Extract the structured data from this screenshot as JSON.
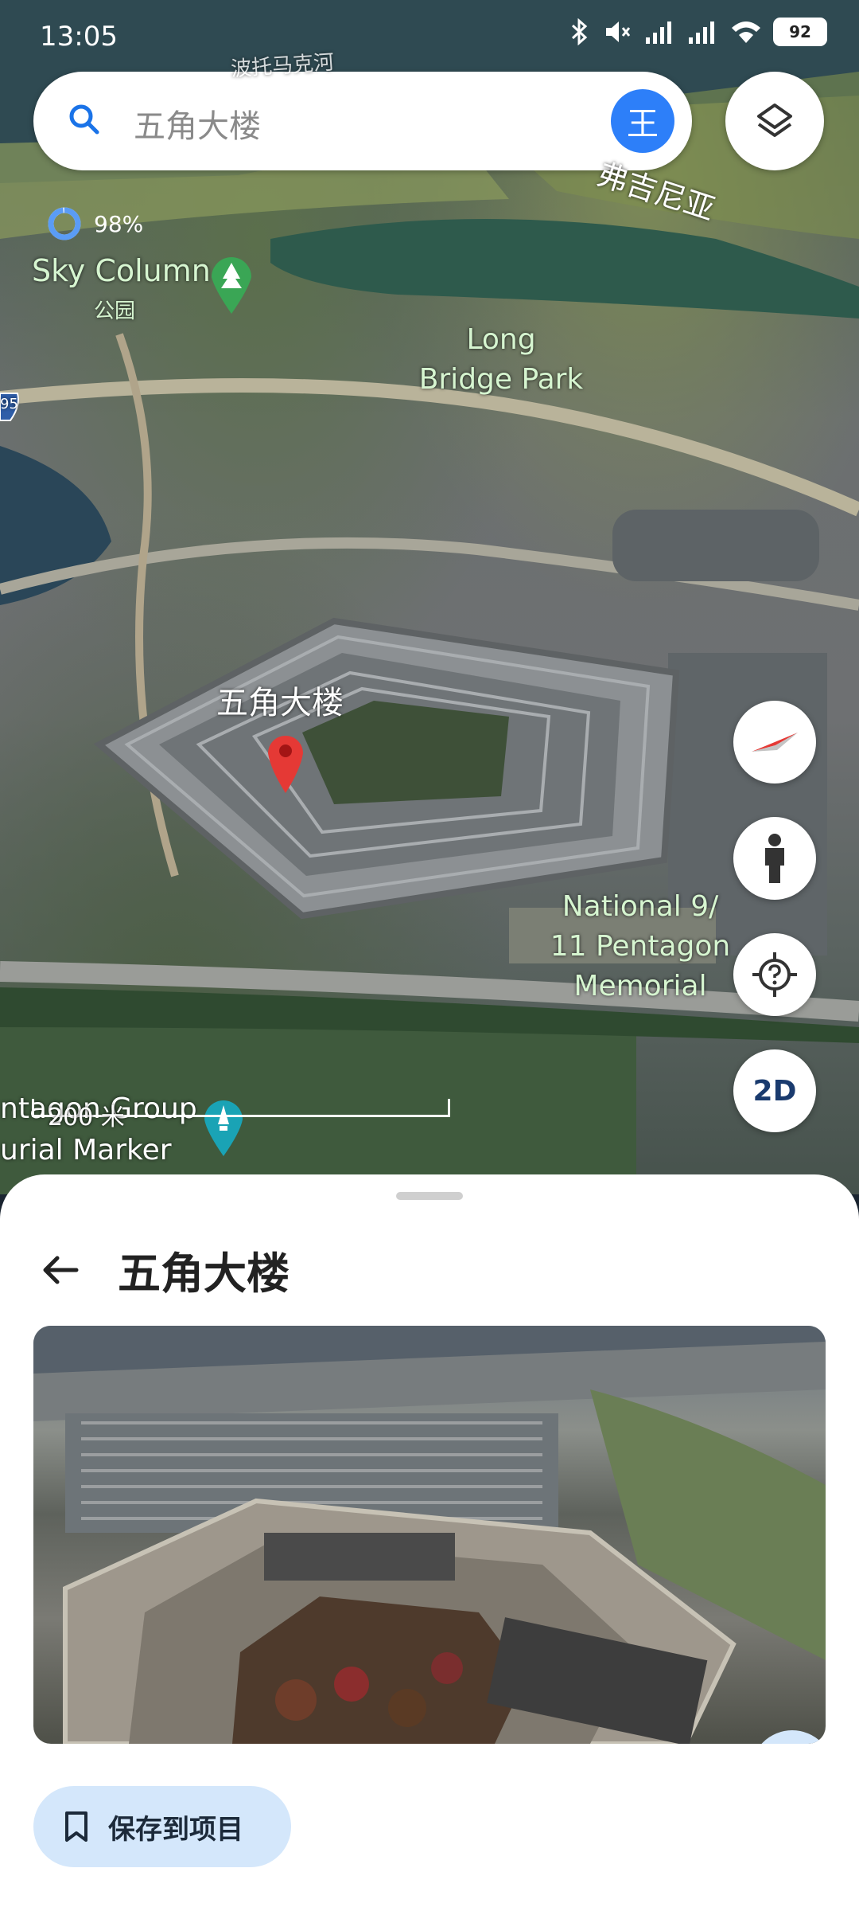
{
  "status_bar": {
    "time": "13:05",
    "battery": "92"
  },
  "search": {
    "query": "五角大楼",
    "avatar_initial": "王"
  },
  "loading": {
    "percent": "98%"
  },
  "map_labels": {
    "river_top": "波托马克河",
    "virginia": "弗吉尼亚",
    "sky_column": "Sky Column",
    "park_sub": "公园",
    "long_bridge_1": "Long",
    "long_bridge_2": "Bridge Park",
    "pentagon": "五角大楼",
    "memorial_1": "National 9/",
    "memorial_2": "11 Pentagon",
    "memorial_3": "Memorial",
    "group_1": "ntagon Group",
    "group_2": "urial Marker",
    "highway_shield": "95"
  },
  "map_controls": {
    "mode_2d": "2D"
  },
  "scale": {
    "label": "200 米"
  },
  "sheet": {
    "title": "五角大楼",
    "save_label": "保存到项目"
  },
  "colors": {
    "accent": "#2d7ff9",
    "pin": "#e53935",
    "chip_bg": "#d4e7fb"
  },
  "icons": [
    "search-icon",
    "layers-icon",
    "compass-icon",
    "pegman-icon",
    "help-location-icon",
    "back-arrow-icon",
    "chevron-right-icon",
    "bookmark-icon",
    "location-pin-icon"
  ]
}
